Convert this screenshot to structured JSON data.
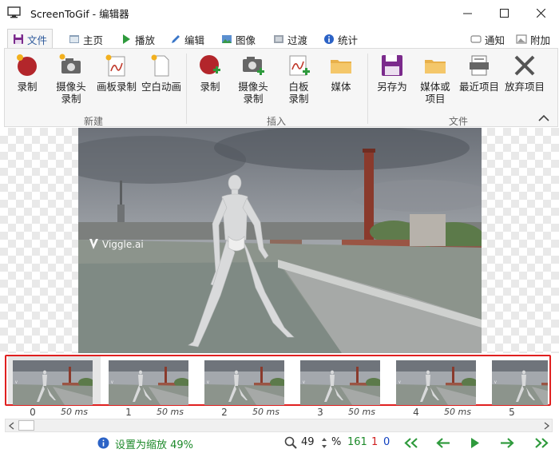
{
  "window": {
    "title": "ScreenToGif - 编辑器"
  },
  "tabs": [
    {
      "label": "文件"
    },
    {
      "label": "主页"
    },
    {
      "label": "播放"
    },
    {
      "label": "编辑"
    },
    {
      "label": "图像"
    },
    {
      "label": "过渡"
    },
    {
      "label": "统计"
    }
  ],
  "tab_right": {
    "notify_label": "通知",
    "extras_label": "附加"
  },
  "ribbon": {
    "new_group": {
      "label": "新建",
      "buttons": [
        {
          "line1": "录制",
          "line2": ""
        },
        {
          "line1": "摄像头",
          "line2": "录制"
        },
        {
          "line1": "画板录制",
          "line2": ""
        },
        {
          "line1": "空白动画",
          "line2": ""
        }
      ]
    },
    "insert_group": {
      "label": "插入",
      "buttons": [
        {
          "line1": "录制",
          "line2": ""
        },
        {
          "line1": "摄像头",
          "line2": "录制"
        },
        {
          "line1": "白板",
          "line2": "录制"
        },
        {
          "line1": "媒体",
          "line2": ""
        }
      ]
    },
    "file_group": {
      "label": "文件",
      "buttons": [
        {
          "line1": "另存为",
          "line2": ""
        },
        {
          "line1": "媒体或",
          "line2": "项目"
        },
        {
          "line1": "最近项目",
          "line2": ""
        },
        {
          "line1": "放弃项目",
          "line2": ""
        }
      ]
    }
  },
  "preview": {
    "watermark": "Viggle.ai"
  },
  "frames": [
    {
      "number": "0",
      "delay": "50 ms"
    },
    {
      "number": "1",
      "delay": "50 ms"
    },
    {
      "number": "2",
      "delay": "50 ms"
    },
    {
      "number": "3",
      "delay": "50 ms"
    },
    {
      "number": "4",
      "delay": "50 ms"
    },
    {
      "number": "5",
      "delay": ""
    }
  ],
  "status": {
    "message": "设置为缩放 49%",
    "zoom_value": "49",
    "zoom_unit": "%",
    "total_frames": "161",
    "selected_frames": "1",
    "current_frame": "0"
  },
  "colors": {
    "accent_blue": "#2b579a",
    "record_red": "#b3262b",
    "status_green": "#1d8a2a",
    "status_red": "#d02020",
    "status_blue": "#1040c0",
    "nav_green": "#2e9a3c",
    "highlight_red": "#e02020"
  }
}
